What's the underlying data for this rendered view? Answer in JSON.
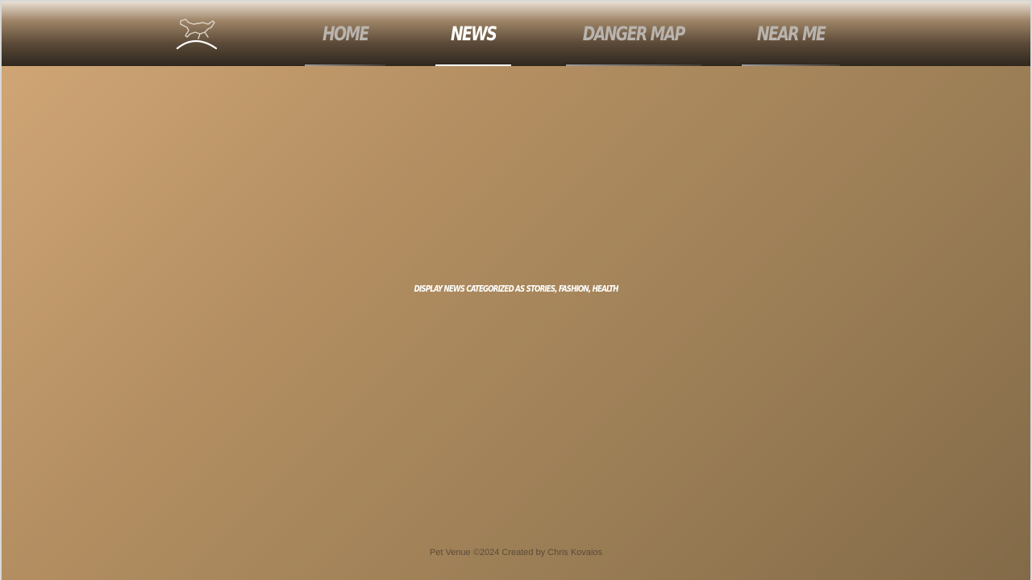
{
  "nav": {
    "logo_icon": "leaping-dog-logo-icon",
    "items": [
      {
        "label": "HOME",
        "active": false
      },
      {
        "label": "NEWS",
        "active": true
      },
      {
        "label": "DANGER MAP",
        "active": false
      },
      {
        "label": "NEAR ME",
        "active": false
      }
    ]
  },
  "main": {
    "placeholder_text": "DISPLAY NEWS CATEGORIZED AS STORIES, FASHION, HEALTH"
  },
  "footer": {
    "text": "Pet Venue ©2024 Created by Chris Kovaios"
  },
  "colors": {
    "active_nav": "#ffffff",
    "inactive_nav": "#b9b4ae",
    "background_start": "#d3a878",
    "background_end": "#836a48"
  }
}
